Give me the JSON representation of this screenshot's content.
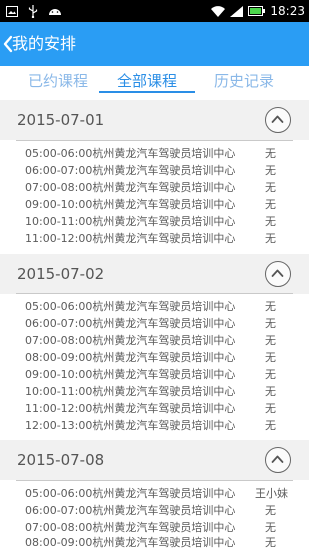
{
  "status_bar": {
    "time": "18:23"
  },
  "header": {
    "title": "我的安排"
  },
  "tabs": [
    {
      "label": "已约课程",
      "active": false
    },
    {
      "label": "全部课程",
      "active": true
    },
    {
      "label": "历史记录",
      "active": false
    }
  ],
  "sections": [
    {
      "date": "2015-07-01",
      "rows": [
        {
          "time": "05:00-06:00",
          "location": "杭州黄龙汽车驾驶员培训中心",
          "status": "无"
        },
        {
          "time": "06:00-07:00",
          "location": "杭州黄龙汽车驾驶员培训中心",
          "status": "无"
        },
        {
          "time": "07:00-08:00",
          "location": "杭州黄龙汽车驾驶员培训中心",
          "status": "无"
        },
        {
          "time": "09:00-10:00",
          "location": "杭州黄龙汽车驾驶员培训中心",
          "status": "无"
        },
        {
          "time": "10:00-11:00",
          "location": "杭州黄龙汽车驾驶员培训中心",
          "status": "无"
        },
        {
          "time": "11:00-12:00",
          "location": "杭州黄龙汽车驾驶员培训中心",
          "status": "无"
        }
      ]
    },
    {
      "date": "2015-07-02",
      "rows": [
        {
          "time": "05:00-06:00",
          "location": "杭州黄龙汽车驾驶员培训中心",
          "status": "无"
        },
        {
          "time": "06:00-07:00",
          "location": "杭州黄龙汽车驾驶员培训中心",
          "status": "无"
        },
        {
          "time": "07:00-08:00",
          "location": "杭州黄龙汽车驾驶员培训中心",
          "status": "无"
        },
        {
          "time": "08:00-09:00",
          "location": "杭州黄龙汽车驾驶员培训中心",
          "status": "无"
        },
        {
          "time": "09:00-10:00",
          "location": "杭州黄龙汽车驾驶员培训中心",
          "status": "无"
        },
        {
          "time": "10:00-11:00",
          "location": "杭州黄龙汽车驾驶员培训中心",
          "status": "无"
        },
        {
          "time": "11:00-12:00",
          "location": "杭州黄龙汽车驾驶员培训中心",
          "status": "无"
        },
        {
          "time": "12:00-13:00",
          "location": "杭州黄龙汽车驾驶员培训中心",
          "status": "无"
        }
      ]
    },
    {
      "date": "2015-07-08",
      "rows": [
        {
          "time": "05:00-06:00",
          "location": "杭州黄龙汽车驾驶员培训中心",
          "status": "王小妹"
        },
        {
          "time": "06:00-07:00",
          "location": "杭州黄龙汽车驾驶员培训中心",
          "status": "无"
        },
        {
          "time": "07:00-08:00",
          "location": "杭州黄龙汽车驾驶员培训中心",
          "status": "无"
        },
        {
          "time": "08:00-09:00",
          "location": "杭州黄龙汽车驾驶员培训中心",
          "status": "无"
        }
      ]
    }
  ]
}
